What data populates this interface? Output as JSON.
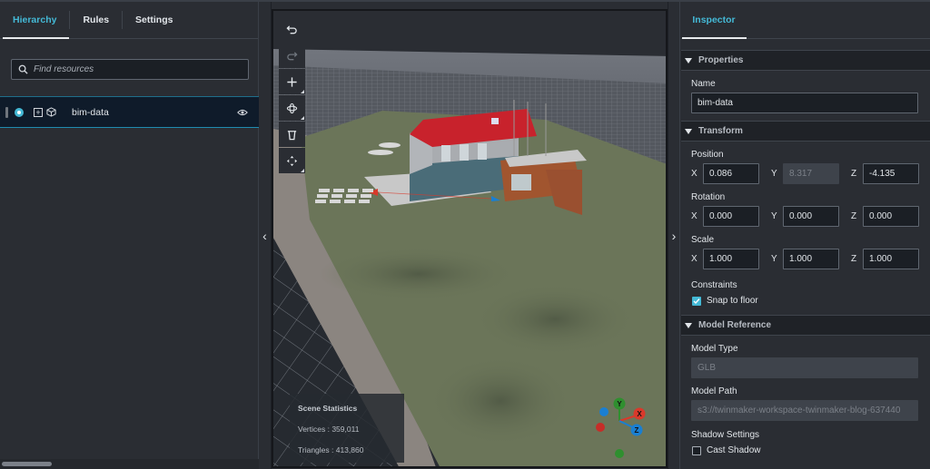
{
  "left_panel": {
    "tabs": [
      {
        "label": "Hierarchy",
        "active": true
      },
      {
        "label": "Rules",
        "active": false
      },
      {
        "label": "Settings",
        "active": false
      }
    ],
    "search": {
      "placeholder": "Find resources",
      "value": ""
    },
    "hierarchy_items": [
      {
        "label": "bim-data",
        "selected": true,
        "visible": true
      }
    ]
  },
  "viewport": {
    "toolbar": [
      {
        "name": "undo",
        "icon": "undo-icon"
      },
      {
        "name": "redo",
        "icon": "redo-icon",
        "disabled": true
      },
      {
        "name": "add",
        "icon": "plus-icon"
      },
      {
        "name": "orbit",
        "icon": "orbit-icon"
      },
      {
        "name": "delete",
        "icon": "trash-icon"
      },
      {
        "name": "transform",
        "icon": "move-icon"
      }
    ],
    "scene_statistics": {
      "title": "Scene Statistics",
      "vertices": "Vertices : 359,011",
      "triangles": "Triangles : 413,860"
    },
    "gizmo": {
      "x": "X",
      "y": "Y",
      "z": "Z",
      "x_color": "#d9392b",
      "y_color": "#2f8f2f",
      "z_color": "#1a7fd1"
    }
  },
  "inspector": {
    "tab": "Inspector",
    "sections": {
      "properties": "Properties",
      "transform": "Transform",
      "model_reference": "Model Reference"
    },
    "name_label": "Name",
    "name_value": "bim-data",
    "position": {
      "label": "Position",
      "x": "0.086",
      "y": "8.317",
      "z": "-4.135",
      "y_disabled": true
    },
    "rotation": {
      "label": "Rotation",
      "x": "0.000",
      "y": "0.000",
      "z": "0.000"
    },
    "scale": {
      "label": "Scale",
      "x": "1.000",
      "y": "1.000",
      "z": "1.000"
    },
    "axis_labels": {
      "x": "X",
      "y": "Y",
      "z": "Z"
    },
    "constraints_label": "Constraints",
    "snap_to_floor": {
      "label": "Snap to floor",
      "checked": true
    },
    "model_type_label": "Model Type",
    "model_type_value": "GLB",
    "model_path_label": "Model Path",
    "model_path_value": "s3://twinmaker-workspace-twinmaker-blog-637440",
    "shadow_settings_label": "Shadow Settings",
    "cast_shadow": {
      "label": "Cast Shadow",
      "checked": false
    }
  },
  "colors": {
    "accent": "#44b9d6",
    "roof": "#c8222c",
    "ground": "#6b7559"
  }
}
